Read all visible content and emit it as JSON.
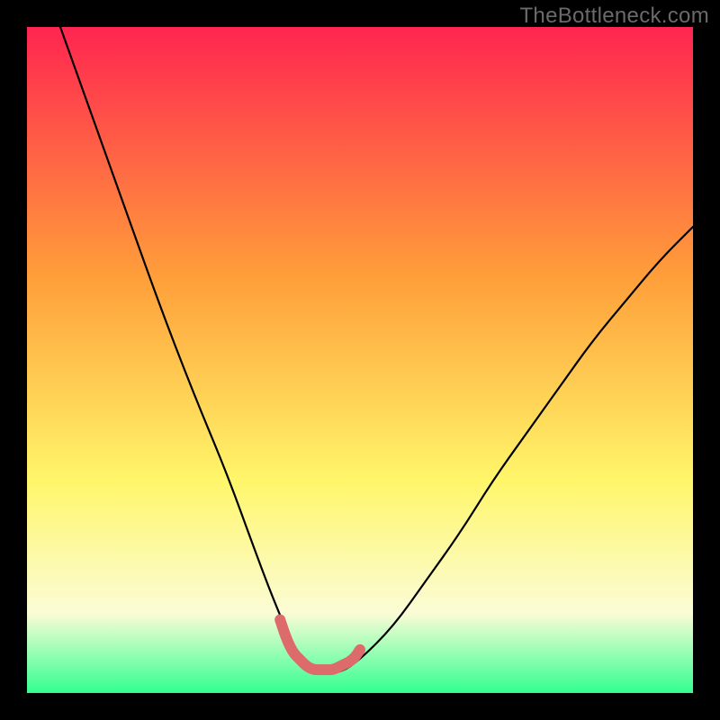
{
  "watermark": "TheBottleneck.com",
  "chart_data": {
    "type": "line",
    "title": "",
    "xlabel": "",
    "ylabel": "",
    "xlim": [
      0,
      100
    ],
    "ylim": [
      0,
      100
    ],
    "plot_background_gradient_colors": [
      "#ff2550",
      "#ffa03a",
      "#fff66a",
      "#fbfcd6",
      "#32ff90"
    ],
    "series": [
      {
        "name": "bottleneck-curve",
        "type": "line",
        "color": "#000000",
        "x": [
          5,
          10,
          15,
          20,
          25,
          30,
          34,
          37,
          40,
          42,
          44,
          47,
          50,
          55,
          60,
          65,
          70,
          75,
          80,
          85,
          90,
          95,
          100
        ],
        "y": [
          100,
          86,
          72,
          58,
          45,
          33,
          22,
          14,
          7,
          4,
          3,
          3,
          5,
          10,
          17,
          24,
          32,
          39,
          46,
          53,
          59,
          65,
          70
        ]
      },
      {
        "name": "optimal-range-marker",
        "type": "line",
        "color": "#dd6b6b",
        "x": [
          38,
          39,
          40,
          41,
          42,
          43,
          44,
          45,
          46,
          47,
          49,
          50
        ],
        "y": [
          11,
          8,
          6,
          5,
          4,
          3.5,
          3.5,
          3.5,
          3.5,
          4,
          5,
          6.5
        ]
      }
    ]
  }
}
